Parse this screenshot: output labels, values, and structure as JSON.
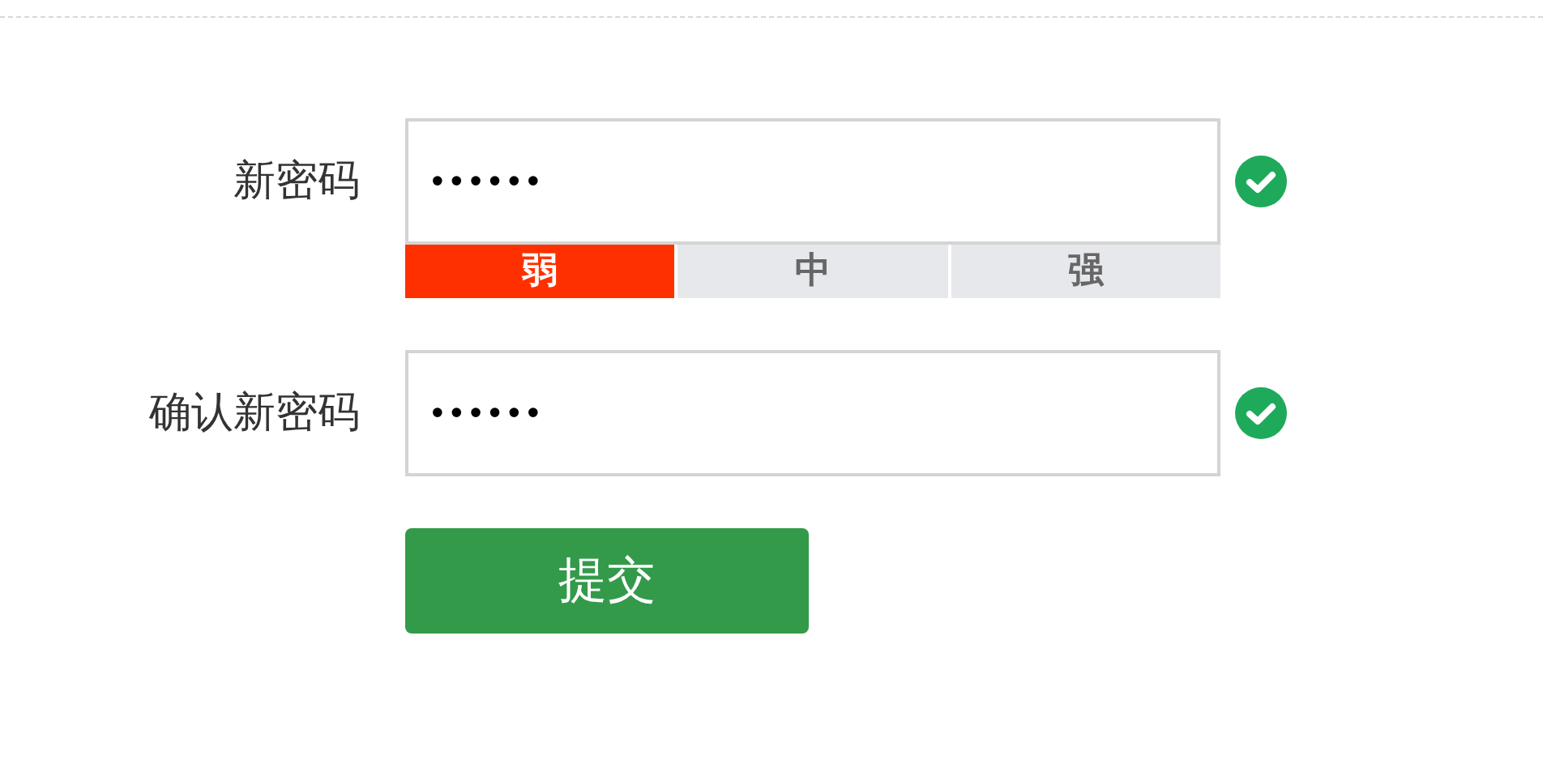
{
  "fields": [
    {
      "label": "新密码",
      "value": "••••••",
      "valid": true,
      "strength": [
        {
          "label": "弱",
          "on": true
        },
        {
          "label": "中",
          "on": false
        },
        {
          "label": "强",
          "on": false
        }
      ]
    },
    {
      "label": "确认新密码",
      "value": "••••••",
      "valid": true
    }
  ],
  "submit": "提交"
}
